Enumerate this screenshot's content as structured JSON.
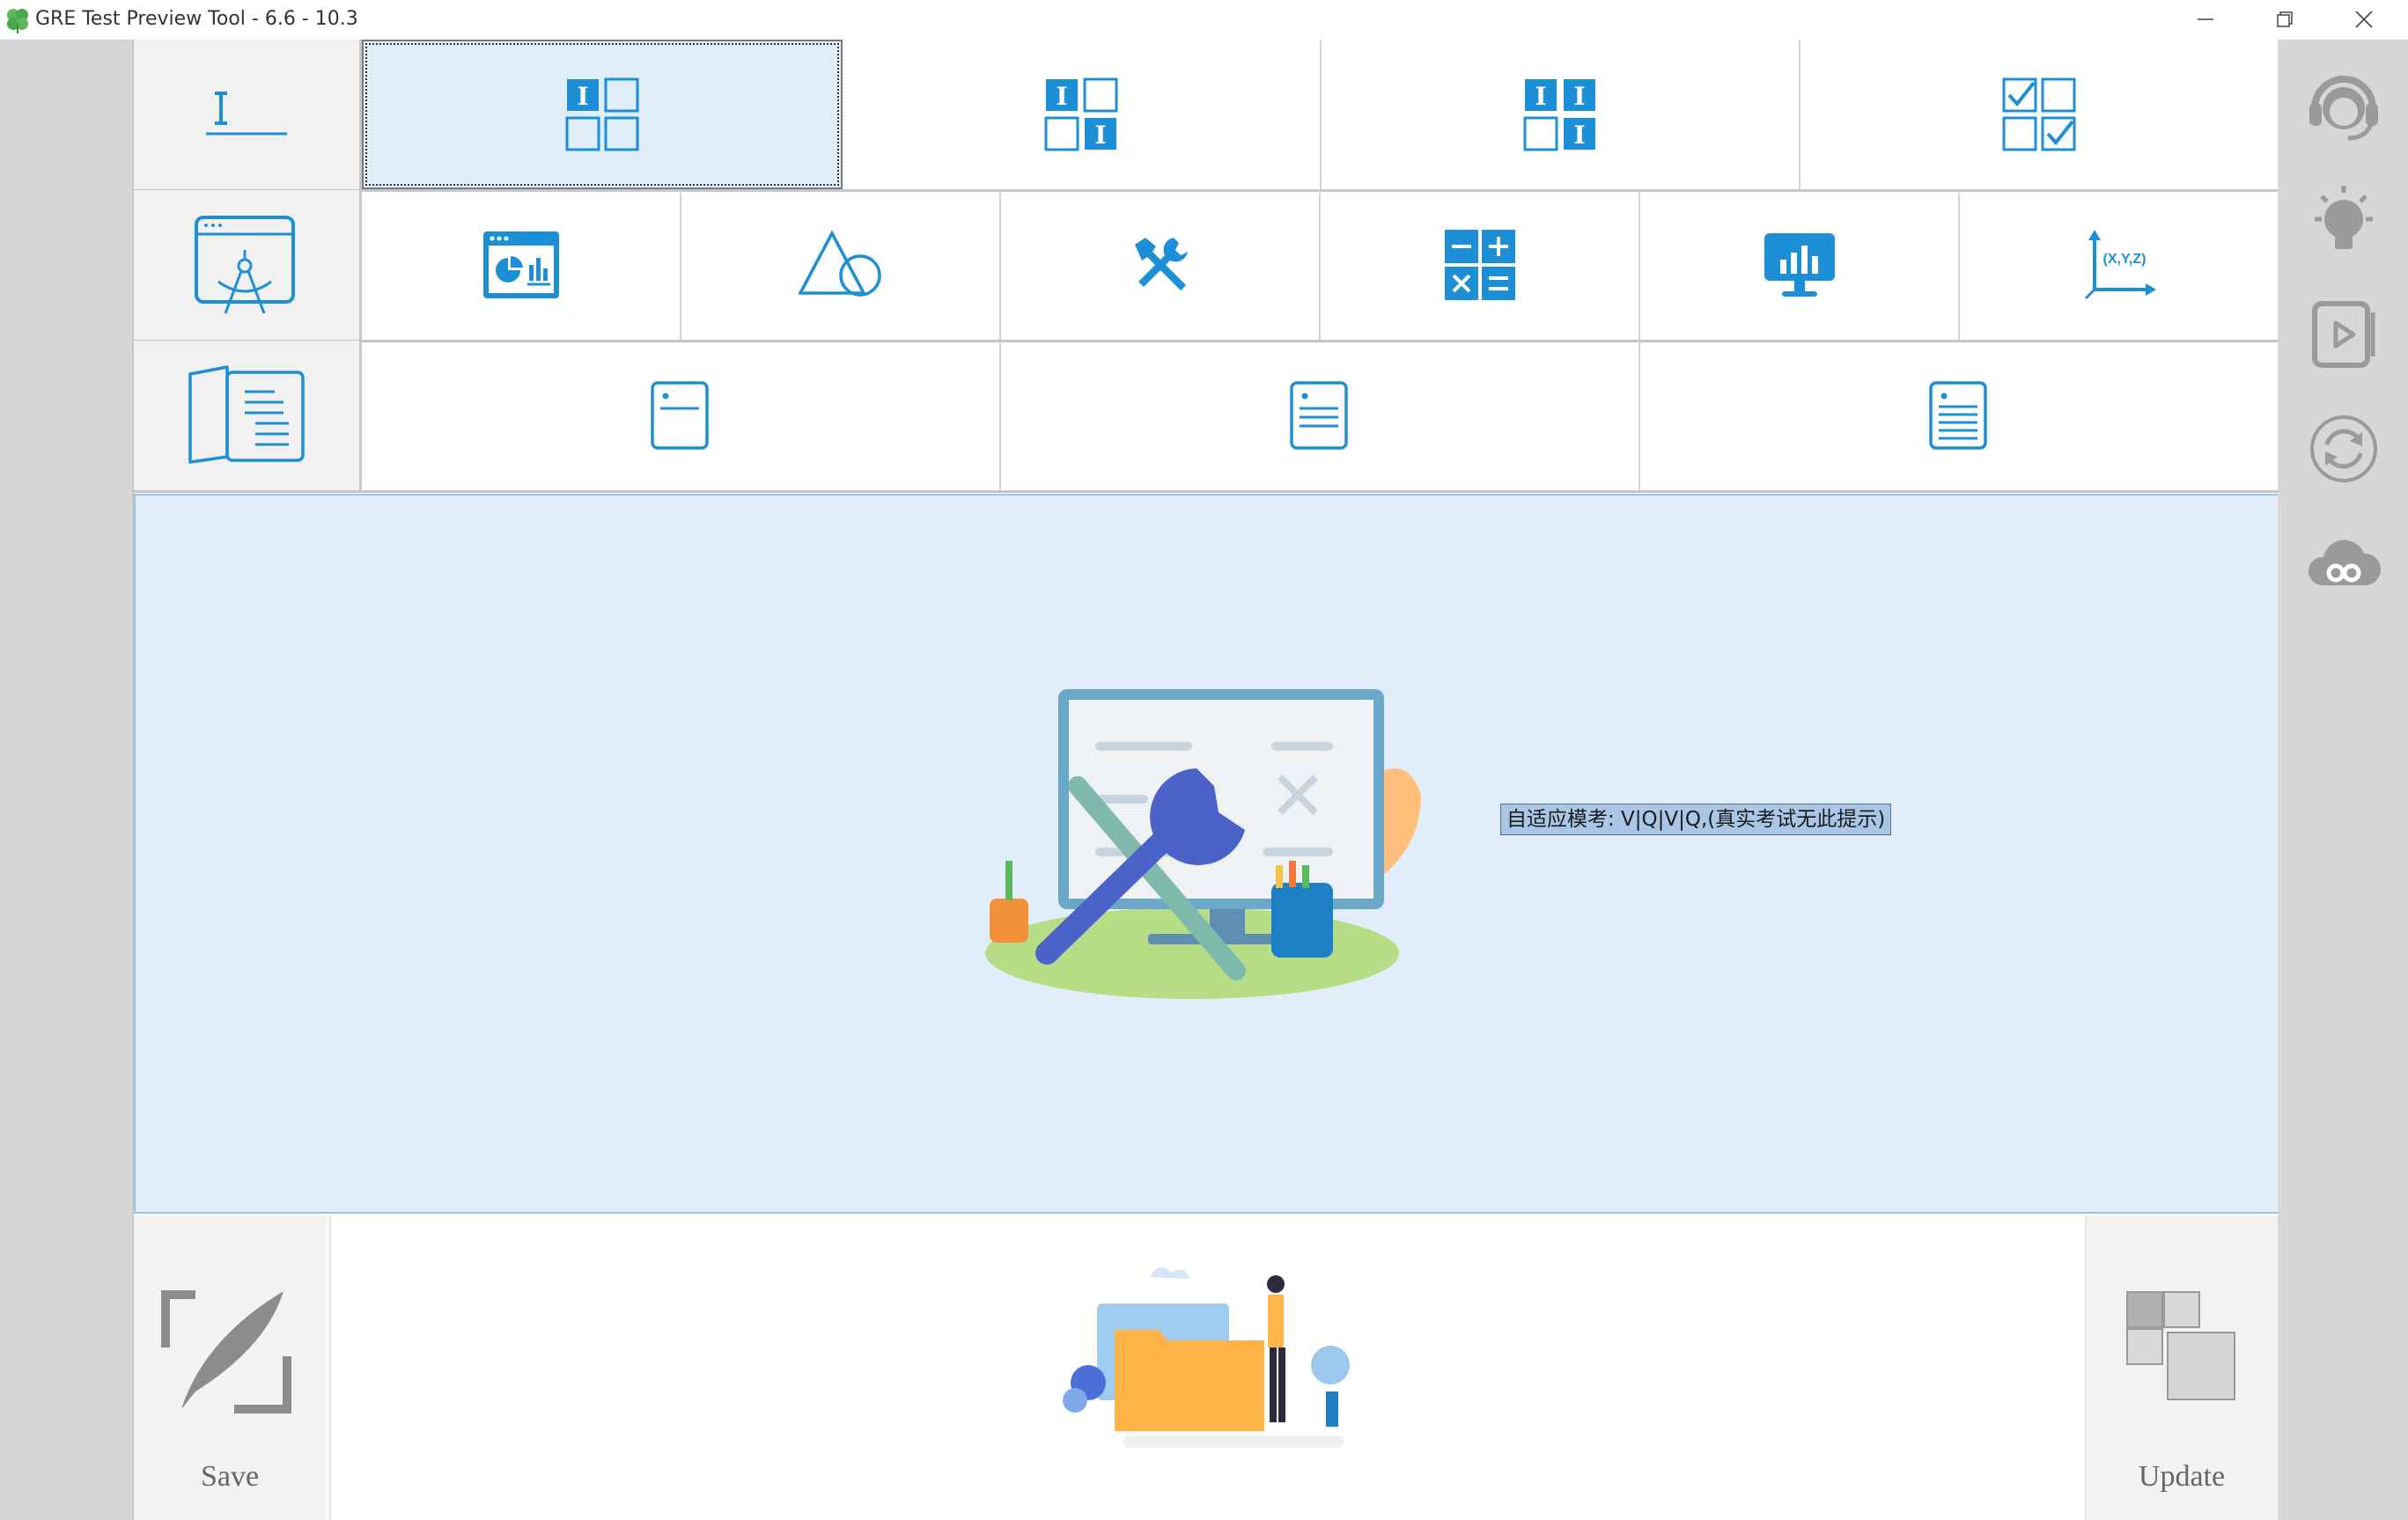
{
  "window": {
    "title": "GRE Test Preview Tool - 6.6 - 10.3",
    "controls": [
      "minimize-icon",
      "restore-icon",
      "close-icon"
    ]
  },
  "toolbar": {
    "row1": {
      "head_icon": "text-cursor-icon",
      "cells": [
        {
          "icon": "text-grid-single-icon",
          "selected": true
        },
        {
          "icon": "text-grid-diagonal-icon",
          "selected": false
        },
        {
          "icon": "text-grid-four-icon",
          "selected": false
        },
        {
          "icon": "checkbox-grid-icon",
          "selected": false
        }
      ]
    },
    "row2": {
      "head_icon": "compass-window-icon",
      "cells": [
        {
          "icon": "dashboard-window-icon"
        },
        {
          "icon": "triangle-circle-icon"
        },
        {
          "icon": "tools-icon"
        },
        {
          "icon": "calculator-icon"
        },
        {
          "icon": "monitor-chart-icon"
        },
        {
          "icon": "xyz-axes-icon",
          "label": "(X,Y,Z)"
        }
      ]
    },
    "row3": {
      "head_icon": "open-book-icon",
      "cells": [
        {
          "icon": "document-short-icon"
        },
        {
          "icon": "document-medium-icon"
        },
        {
          "icon": "document-long-icon"
        }
      ]
    }
  },
  "workspace": {
    "illustration": "monitor-tools-illustration",
    "mode_label": "自适应模考: V|Q|V|Q,(真实考试无此提示)"
  },
  "bottom": {
    "save_label": "Save",
    "center_illustration": "folder-person-illustration",
    "update_label": "Update"
  },
  "sidebar": {
    "items": [
      "headset-support-icon",
      "lightbulb-icon",
      "play-video-icon",
      "refresh-icon",
      "cloud-link-icon"
    ]
  },
  "colors": {
    "accent": "#1d8fd6",
    "selected_bg": "#e0eef9",
    "workspace_bg": "#e1eef9",
    "sidebar_icon": "#9a9a9a"
  }
}
